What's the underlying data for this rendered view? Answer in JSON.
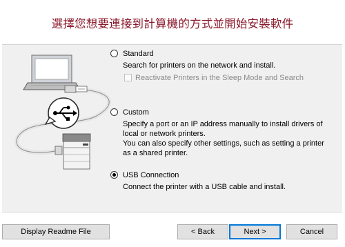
{
  "header": {
    "title": "選擇您想要連接到計算機的方式並開始安裝軟件"
  },
  "options": [
    {
      "label": "Standard",
      "description": "Search for printers on the network and install.",
      "checkbox_label": "Reactivate Printers in the Sleep Mode and Search",
      "checkbox_checked": false,
      "checkbox_enabled": false,
      "selected": false
    },
    {
      "label": "Custom",
      "description_lines": [
        "Specify a port or an IP address manually to install drivers of",
        "local or network printers.",
        "You can also specify other settings, such as setting a printer",
        "as a shared printer."
      ],
      "selected": false
    },
    {
      "label": "USB Connection",
      "description": "Connect the printer with a USB cable and install.",
      "selected": true
    }
  ],
  "buttons": {
    "readme": "Display Readme File",
    "back": "< Back",
    "next": "Next >",
    "cancel": "Cancel"
  },
  "illustration": {
    "icons": [
      "laptop-icon",
      "usb-symbol-icon",
      "printer-icon"
    ]
  },
  "colors": {
    "title": "#8b1a2c",
    "panel": "#f0f0f0",
    "default_button_border": "#0078d7"
  }
}
